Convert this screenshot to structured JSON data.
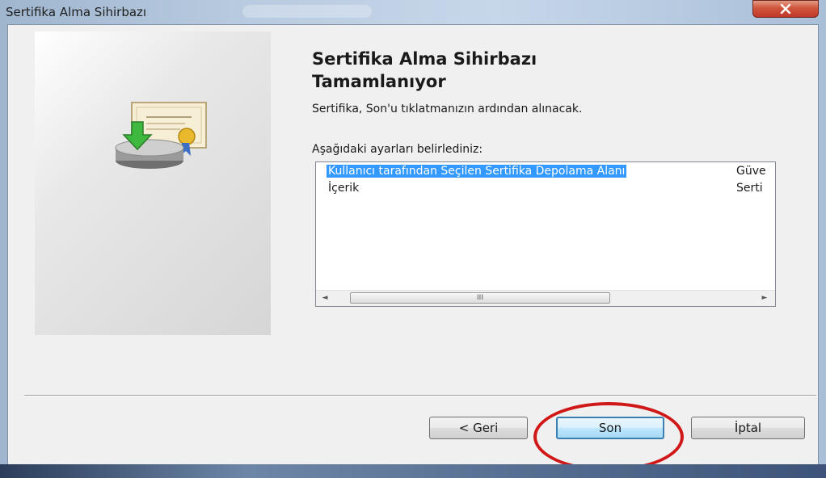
{
  "window": {
    "title": "Sertifika Alma Sihirbazı",
    "close_icon": "close-icon",
    "close_symbol": "✕"
  },
  "wizard": {
    "heading_line1": "Sertifika Alma Sihirbazı",
    "heading_line2": "Tamamlanıyor",
    "description": "Sertifika, Son'u tıklatmanızın ardından alınacak.",
    "settings_label": "Aşağıdaki ayarları belirlediniz:",
    "settings_rows": [
      {
        "name": "Kullanıcı tarafından Seçilen Sertifika Depolama Alanı",
        "value": "Güve",
        "selected": true
      },
      {
        "name": "İçerik",
        "value": "Serti",
        "selected": false
      }
    ],
    "scroll_left": "◄",
    "scroll_right": "►",
    "scroll_grip": "III"
  },
  "buttons": {
    "back": "< Geri",
    "finish": "Son",
    "cancel": "İptal"
  },
  "colors": {
    "selection": "#3399ff",
    "highlight_circle": "#d01818",
    "close_button": "#c0392b"
  },
  "icons": {
    "wizard_graphic": "certificate-install-icon"
  }
}
